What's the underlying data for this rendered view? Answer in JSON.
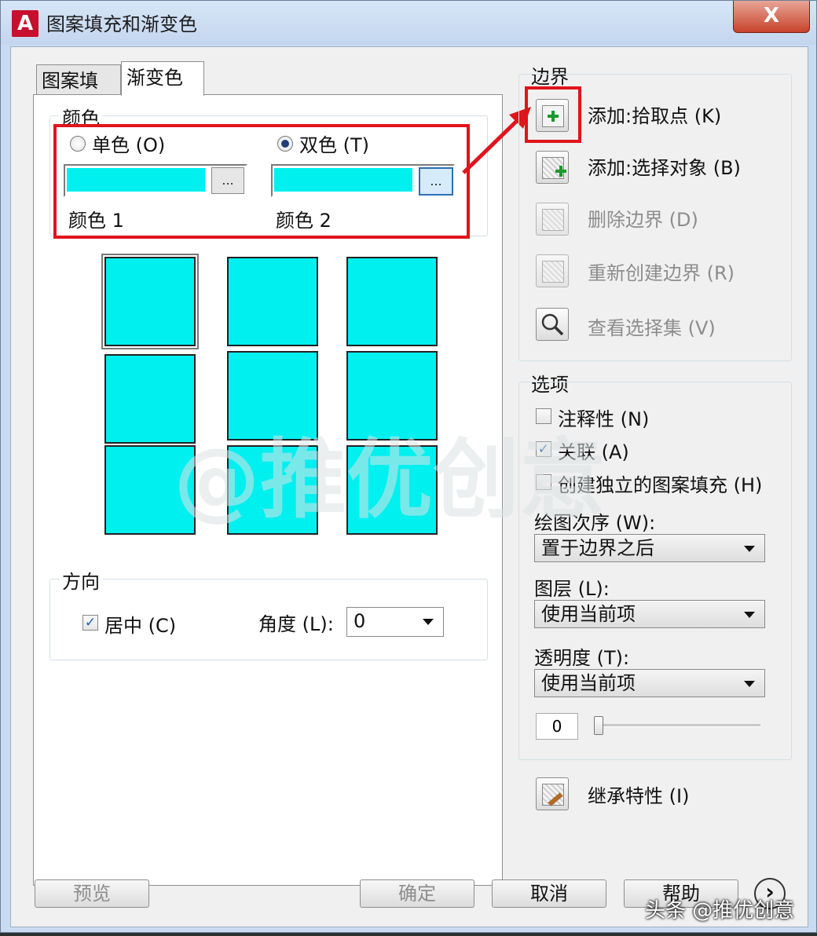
{
  "window": {
    "title": "图案填充和渐变色",
    "close_label": "X",
    "app_logo": "A"
  },
  "tabs": [
    {
      "label": "图案填充"
    },
    {
      "label": "渐变色"
    }
  ],
  "color_group": {
    "label": "颜色",
    "one_color": {
      "label": "单色 (O)",
      "selected": false
    },
    "two_color": {
      "label": "双色 (T)",
      "selected": true
    },
    "color1": {
      "label": "颜色 1",
      "value": "#00f0f0",
      "button": "..."
    },
    "color2": {
      "label": "颜色 2",
      "value": "#00f0f0",
      "button": "..."
    }
  },
  "swatches": {
    "count": 9,
    "selected_index": 0,
    "color": "#00f0f0"
  },
  "orientation": {
    "label": "方向",
    "centered": {
      "label": "居中 (C)",
      "checked": true
    },
    "angle_label": "角度 (L):",
    "angle_value": "0"
  },
  "boundary": {
    "label": "边界",
    "add_pick_points": "添加:拾取点 (K)",
    "add_select_objects": "添加:选择对象 (B)",
    "remove_boundaries": "删除边界 (D)",
    "recreate_boundary": "重新创建边界 (R)",
    "view_selections": "查看选择集 (V)"
  },
  "options": {
    "label": "选项",
    "annotative": {
      "label": "注释性 (N)",
      "checked": false
    },
    "associative": {
      "label": "关联 (A)",
      "checked": true
    },
    "separate": {
      "label": "创建独立的图案填充 (H)",
      "checked": false
    },
    "draw_order_label": "绘图次序 (W):",
    "draw_order_value": "置于边界之后",
    "layer_label": "图层 (L):",
    "layer_value": "使用当前项",
    "transparency_label": "透明度 (T):",
    "transparency_value": "使用当前项",
    "transparency_number": "0",
    "transparency_slider": 0
  },
  "inherit": {
    "label": "继承特性 (I)"
  },
  "footer": {
    "preview": "预览",
    "ok": "确定",
    "cancel": "取消",
    "help": "帮助",
    "more": "›"
  },
  "overlay": {
    "watermark": "@推优创意",
    "credit": "头条 @推优创意"
  },
  "colors": {
    "highlight_red": "#e0141c",
    "gradient_cyan": "#00f0f0"
  }
}
